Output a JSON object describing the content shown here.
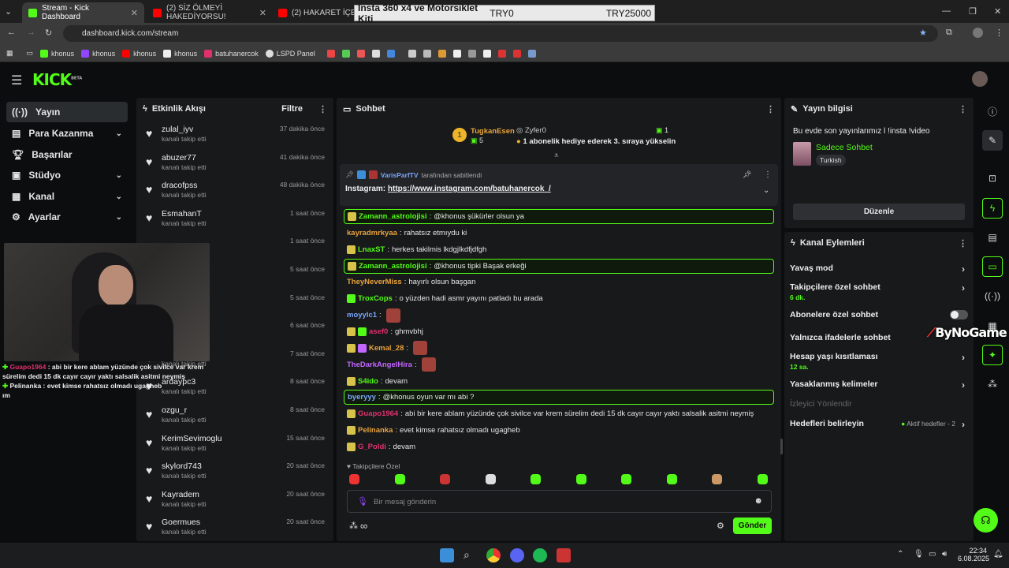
{
  "browser": {
    "tabs": [
      {
        "title": "Stream - Kick Dashboard",
        "favicon_color": "#53fc18"
      },
      {
        "title": "(2) SİZ ÖLMEYİ HAKEDİYORSU!",
        "favicon_color": "#ff0000"
      },
      {
        "title": "(2) HAKARET İÇERİR! Tü",
        "favicon_color": "#ff0000"
      }
    ],
    "tooltip": {
      "title": "Insta 360 x4 ve Motorsiklet Kiti",
      "value1": "TRY0",
      "value2": "TRY25000"
    },
    "url": "dashboard.kick.com/stream",
    "bookmarks": [
      "khonus",
      "khonus",
      "khonus",
      "khonus",
      "batuhanercok",
      "LSPD Panel"
    ]
  },
  "nav": {
    "items": [
      {
        "label": "Yayın",
        "icon": "broadcast-icon"
      },
      {
        "label": "Para Kazanma",
        "icon": "money-icon"
      },
      {
        "label": "Başarılar",
        "icon": "trophy-icon"
      },
      {
        "label": "Stüdyo",
        "icon": "studio-icon"
      },
      {
        "label": "Kanal",
        "icon": "channel-icon"
      },
      {
        "label": "Ayarlar",
        "icon": "gear-icon"
      }
    ]
  },
  "overlay_chat": [
    {
      "user": "Guapo1964",
      "text": "abi bir kere ablam yüzünde çok sivilce var krem sürelim dedi 15 dk cayır cayır yaktı salsalik asitmi neymiş"
    },
    {
      "user": "Pelinanka",
      "text": "evet kimse rahatsız olmadı ugagheb"
    },
    {
      "user": "",
      "text": "ım"
    }
  ],
  "activity": {
    "title": "Etkinlik Akışı",
    "filter": "Filtre",
    "events": [
      {
        "name": "zulal_iyv",
        "sub": "kanalı takip etti",
        "time": "37 dakika önce"
      },
      {
        "name": "abuzer77",
        "sub": "kanalı takip etti",
        "time": "41 dakika önce"
      },
      {
        "name": "dracofpss",
        "sub": "kanalı takip etti",
        "time": "48 dakika önce"
      },
      {
        "name": "EsmahanT",
        "sub": "kanalı takip etti",
        "time": "1 saat önce"
      },
      {
        "name": "",
        "sub": "",
        "time": "1 saat önce"
      },
      {
        "name": "",
        "sub": "",
        "time": "5 saat önce"
      },
      {
        "name": "",
        "sub": "",
        "time": "5 saat önce"
      },
      {
        "name": "",
        "sub": "",
        "time": "6 saat önce"
      },
      {
        "name": "",
        "sub": "kanalı takip etti",
        "time": "7 saat önce"
      },
      {
        "name": "ardaypc3",
        "sub": "kanalı takip etti",
        "time": "8 saat önce"
      },
      {
        "name": "ozgu_r",
        "sub": "kanalı takip etti",
        "time": "8 saat önce"
      },
      {
        "name": "KerimSevimoglu",
        "sub": "kanalı takip etti",
        "time": "15 saat önce"
      },
      {
        "name": "skylord743",
        "sub": "kanalı takip etti",
        "time": "20 saat önce"
      },
      {
        "name": "Kayradem",
        "sub": "kanalı takip etti",
        "time": "20 saat önce"
      },
      {
        "name": "Goermues",
        "sub": "kanalı takip etti",
        "time": "20 saat önce"
      }
    ]
  },
  "chat": {
    "title": "Sohbet",
    "leaderboard": {
      "first_user": "TugkanEsen",
      "first_count": "5",
      "second_user": "Zyfer0",
      "second_count": "1",
      "gift_text": "1 abonelik hediye ederek 3. sıraya yükselin",
      "rank": "1"
    },
    "pinned": {
      "pinned_by_user": "VarisParfTV",
      "pinned_by_text": "tarafından sabitlendi",
      "label": "Instagram:",
      "link": "https://www.instagram.com/batuhanercok_/"
    },
    "messages": [
      {
        "user": "Zamann_astrolojisi",
        "color": "#53fc18",
        "text": "@khonus şükürler olsun ya",
        "highlight": true
      },
      {
        "user": "kayradmrkyaa",
        "color": "#e8a33d",
        "text": "rahatsız etmıydu ki",
        "highlight": false
      },
      {
        "user": "LnaxST",
        "color": "#53fc18",
        "text": "herkes takilmis lkdgjlkdfjdfgh",
        "highlight": false
      },
      {
        "user": "Zamann_astrolojisi",
        "color": "#53fc18",
        "text": "@khonus tipki Başak erkeği",
        "highlight": true
      },
      {
        "user": "TheyNeverMiss",
        "color": "#e8a33d",
        "text": "hayırlı olsun başgan",
        "highlight": false
      },
      {
        "user": "TroxCops",
        "color": "#53fc18",
        "text": "o yüzden hadi asmr yayını patladı bu arada",
        "highlight": false
      },
      {
        "user": "moyylc1",
        "color": "#7aa7ff",
        "text": "",
        "highlight": false
      },
      {
        "user": "asef0",
        "color": "#e0316b",
        "text": "ghmvbhj",
        "highlight": false
      },
      {
        "user": "Kemal_28",
        "color": "#e8a33d",
        "text": "",
        "highlight": false
      },
      {
        "user": "TheDarkAngelHira",
        "color": "#c266ff",
        "text": "",
        "highlight": false
      },
      {
        "user": "S4ido",
        "color": "#53fc18",
        "text": "devam",
        "highlight": false
      },
      {
        "user": "byeryyy",
        "color": "#7aa7ff",
        "text": "@khonus oyun var mı abi ?",
        "highlight": true
      },
      {
        "user": "Guapo1964",
        "color": "#e0316b",
        "text": "abi bir kere ablam yüzünde çok sivilce var krem sürelim dedi 15 dk cayır cayır yaktı salsalik asitmi neymiş",
        "highlight": false
      },
      {
        "user": "Pelinanka",
        "color": "#e8a33d",
        "text": "evet kimse rahatsız olmadı ugagheb",
        "highlight": false
      },
      {
        "user": "G_Poldi",
        "color": "#e0316b",
        "text": "devam",
        "highlight": false
      }
    ],
    "followers_only": "Takipçilere Özel",
    "input_placeholder": "Bir mesaj gönderin",
    "send_label": "Gönder"
  },
  "stream_info": {
    "title": "Yayın bilgisi",
    "stream_title": "Bu evde son yayınlarımız l !insta !video",
    "category": "Sadece Sohbet",
    "tag": "Turkish",
    "edit_label": "Düzenle"
  },
  "channel_actions": {
    "title": "Kanal Eylemleri",
    "items": [
      {
        "label": "Yavaş mod",
        "sub": ""
      },
      {
        "label": "Takipçilere özel sohbet",
        "sub": "6 dk."
      },
      {
        "label": "Abonelere özel sohbet",
        "sub": ""
      },
      {
        "label": "Yalnızca ifadelerle sohbet",
        "sub": ""
      },
      {
        "label": "Hesap yaşı kısıtlaması",
        "sub": "12 sa."
      },
      {
        "label": "Yasaklanmış kelimeler",
        "sub": ""
      },
      {
        "label": "İzleyici Yönlendir",
        "sub": ""
      },
      {
        "label": "Hedefleri belirleyin",
        "sub": ""
      }
    ],
    "goals_status": "Aktif hedefler - 2"
  },
  "watermark": "ByNoGame",
  "taskbar": {
    "time": "22:34",
    "date": "6.08.2025"
  }
}
